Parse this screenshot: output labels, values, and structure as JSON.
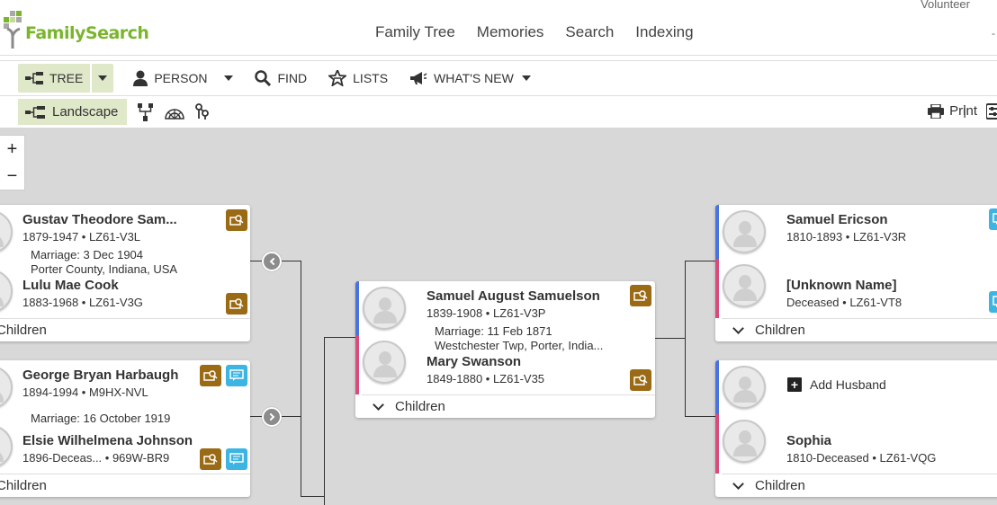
{
  "brand": {
    "name": "FamilySearch",
    "green": "#7ab52d",
    "brown": "#9a6a14"
  },
  "header": {
    "nav": [
      "Family Tree",
      "Memories",
      "Search",
      "Indexing"
    ],
    "volunteer": "Volunteer"
  },
  "toolbar": {
    "tree": "TREE",
    "person": "PERSON",
    "find": "FIND",
    "lists": "LISTS",
    "whats_new": "WHAT'S NEW"
  },
  "toolbar2": {
    "landscape": "Landscape",
    "print": "Print",
    "separator": "|"
  },
  "zoom": {
    "in": "+",
    "out": "−"
  },
  "families": {
    "left1": {
      "husband": {
        "name": "Gustav Theodore Sam...",
        "info": "1879-1947 • LZ61-V3L"
      },
      "marriage_date": "Marriage: 3 Dec 1904",
      "marriage_place": "Porter County, Indiana, USA",
      "wife": {
        "name": "Lulu Mae Cook",
        "info": "1883-1968 • LZ61-V3G"
      },
      "children": "Children"
    },
    "left2": {
      "husband": {
        "name": "George Bryan Harbaugh",
        "info": "1894-1994 • M9HX-NVL"
      },
      "marriage_date": "Marriage: 16 October 1919",
      "wife": {
        "name": "Elsie Wilhelmena Johnson",
        "info": "1896-Deceas...  • 969W-BR9"
      },
      "children": "Children"
    },
    "center": {
      "husband": {
        "name": "Samuel August Samuelson",
        "info": "1839-1908 • LZ61-V3P"
      },
      "marriage_date": "Marriage: 11 Feb 1871",
      "marriage_place": "Westchester Twp, Porter, India...",
      "wife": {
        "name": "Mary Swanson",
        "info": "1849-1880 • LZ61-V35"
      },
      "children": "Children"
    },
    "right1": {
      "husband": {
        "name": "Samuel Ericson",
        "info": "1810-1893 • LZ61-V3R"
      },
      "wife": {
        "name": "[Unknown Name]",
        "info": "Deceased • LZ61-VT8"
      },
      "children": "Children"
    },
    "right2": {
      "add_husband": "Add Husband",
      "wife": {
        "name": "Sophia",
        "info": "1810-Deceased • LZ61-VQG"
      },
      "children": "Children"
    }
  }
}
